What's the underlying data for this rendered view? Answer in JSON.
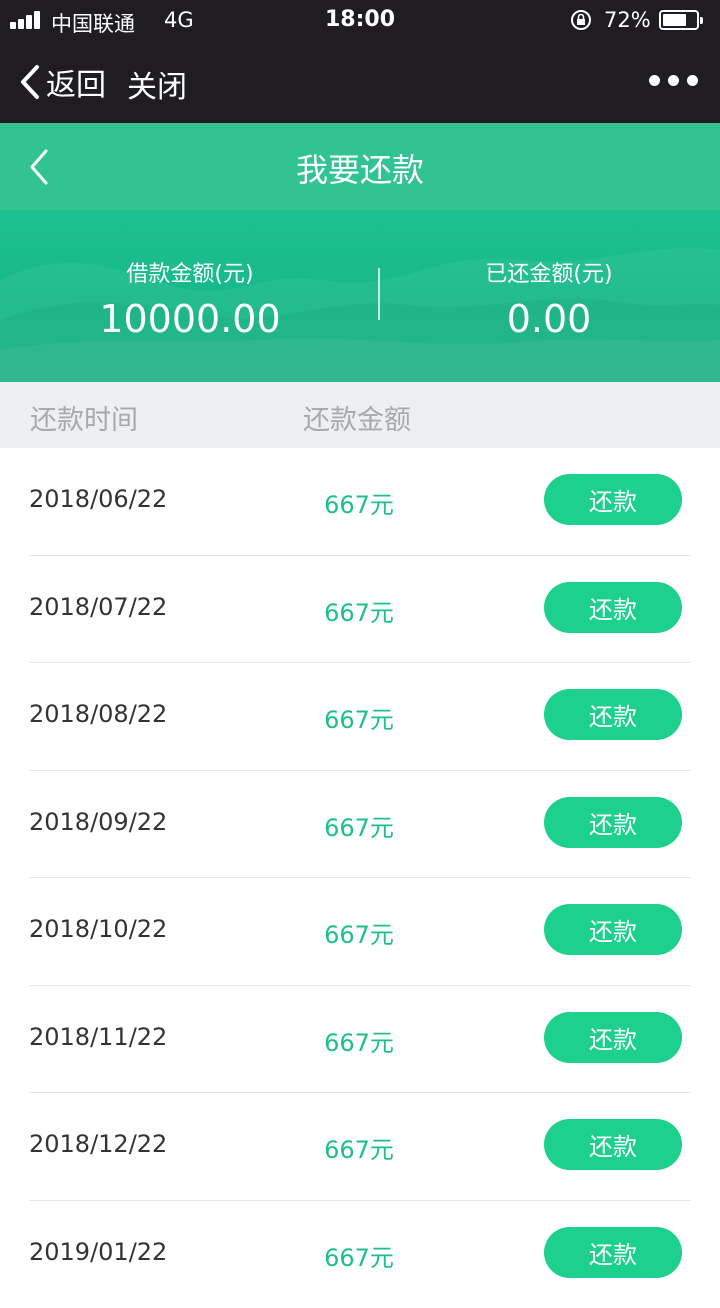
{
  "status_bar": {
    "carrier": "中国联通",
    "network": "4G",
    "time": "18:00",
    "battery_percent": "72%",
    "battery_level": 0.72,
    "icons": [
      "signal-icon",
      "orientation-lock-icon",
      "battery-icon"
    ]
  },
  "nav": {
    "back_label": "返回",
    "close_label": "关闭",
    "more_icon": "more-dots-icon"
  },
  "header": {
    "title": "我要还款",
    "back_icon": "chevron-left-icon"
  },
  "summary": {
    "loan_label": "借款金额(元)",
    "loan_value": "10000.00",
    "repaid_label": "已还金额(元)",
    "repaid_value": "0.00"
  },
  "table": {
    "col_date": "还款时间",
    "col_amount": "还款金额",
    "button_label": "还款",
    "rows": [
      {
        "date": "2018/06/22",
        "amount": "667元"
      },
      {
        "date": "2018/07/22",
        "amount": "667元"
      },
      {
        "date": "2018/08/22",
        "amount": "667元"
      },
      {
        "date": "2018/09/22",
        "amount": "667元"
      },
      {
        "date": "2018/10/22",
        "amount": "667元"
      },
      {
        "date": "2018/11/22",
        "amount": "667元"
      },
      {
        "date": "2018/12/22",
        "amount": "667元"
      },
      {
        "date": "2019/01/22",
        "amount": "667元"
      }
    ]
  },
  "colors": {
    "status_bg": "#1f1d22",
    "header_bg": "#31c391",
    "banner_bg": "#1cc08e",
    "accent": "#1dc188",
    "button_bg": "#1ed08e"
  }
}
